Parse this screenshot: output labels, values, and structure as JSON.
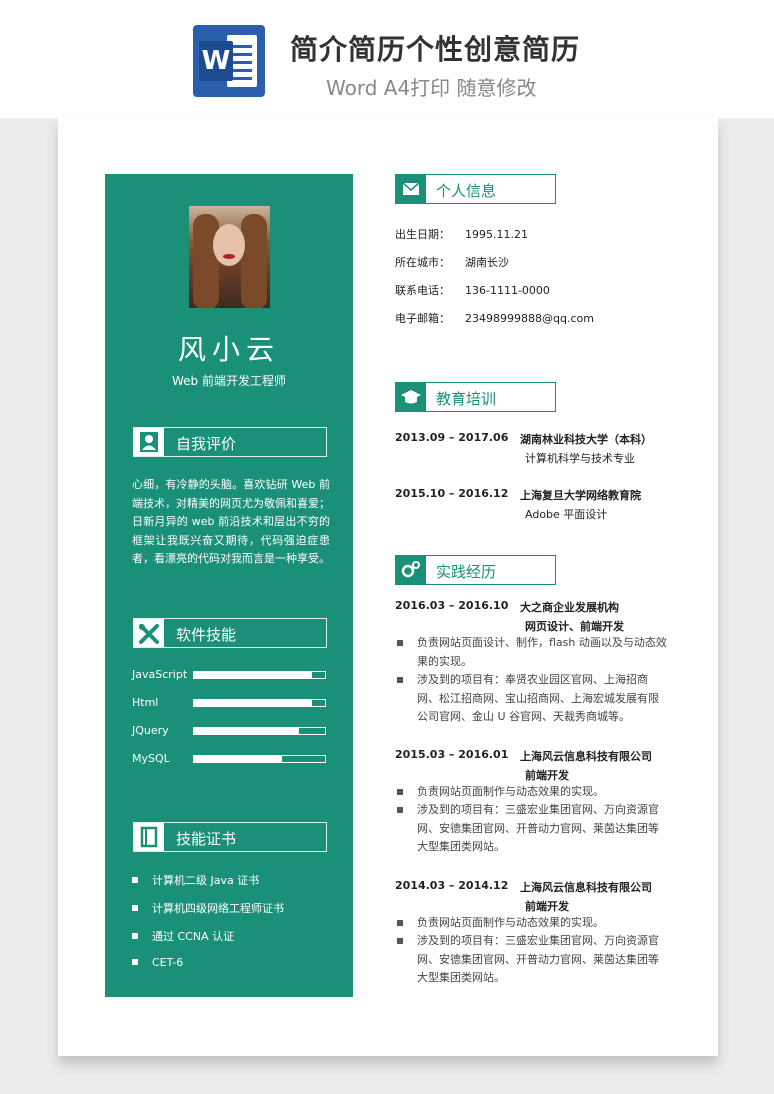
{
  "banner": {
    "title": "简介简历个性创意简历",
    "subtitle": "Word A4打印 随意修改",
    "logo_letter": "W"
  },
  "profile": {
    "name": "风小云",
    "role": "Web 前端开发工程师"
  },
  "sections": {
    "self_eval": "自我评价",
    "skills": "软件技能",
    "certs": "技能证书",
    "personal": "个人信息",
    "education": "教育培训",
    "practice": "实践经历"
  },
  "self_eval_text": "心细，有冷静的头脑。喜欢钻研 Web 前端技术，对精美的网页尤为敬佩和喜爱；日新月异的 web 前沿技术和层出不穷的框架让我既兴奋又期待，代码强迫症患者，看漂亮的代码对我而言是一种享受。",
  "skills": [
    {
      "name": "JavaScript",
      "level": 0.9
    },
    {
      "name": "Html",
      "level": 0.9
    },
    {
      "name": "JQuery",
      "level": 0.8
    },
    {
      "name": "MySQL",
      "level": 0.67
    }
  ],
  "certs": [
    "计算机二级 Java 证书",
    "计算机四级网络工程师证书",
    "通过 CCNA 认证",
    "CET-6"
  ],
  "personal": [
    {
      "label": "出生日期：",
      "value": "1995.11.21"
    },
    {
      "label": "所在城市：",
      "value": "湖南长沙"
    },
    {
      "label": "联系电话：",
      "value": "136-1111-0000"
    },
    {
      "label": "电子邮箱：",
      "value": "23498999888@qq.com"
    }
  ],
  "education": [
    {
      "period": "2013.09 – 2017.06",
      "school": "湖南林业科技大学（本科）",
      "major": "计算机科学与技术专业"
    },
    {
      "period": "2015.10 – 2016.12",
      "school": "上海复旦大学网络教育院",
      "major": "Adobe 平面设计"
    }
  ],
  "practice": [
    {
      "period": "2016.03 – 2016.10",
      "company": "大之商企业发展机构",
      "position": "网页设计、前端开发",
      "items": [
        "负责网站页面设计、制作，flash 动画以及与动态效果的实现。",
        "涉及到的项目有：奉贤农业园区官网、上海招商网、松江招商网、宝山招商网、上海宏城发展有限公司官网、金山 U 谷官网、天裁秀商城等。"
      ]
    },
    {
      "period": "2015.03 – 2016.01",
      "company": "上海风云信息科技有限公司",
      "position": "前端开发",
      "items": [
        "负责网站页面制作与动态效果的实现。",
        "涉及到的项目有：三盛宏业集团官网、万向资源官网、安德集团官网、开普动力官网、莱茵达集团等大型集团类网站。"
      ]
    },
    {
      "period": "2014.03 – 2014.12",
      "company": "上海风云信息科技有限公司",
      "position": "前端开发",
      "items": [
        "负责网站页面制作与动态效果的实现。",
        "涉及到的项目有：三盛宏业集团官网、万向资源官网、安德集团官网、开普动力官网、莱茵达集团等大型集团类网站。"
      ]
    }
  ],
  "colors": {
    "accent": "#1a9079",
    "word_blue": "#2b5fad"
  }
}
